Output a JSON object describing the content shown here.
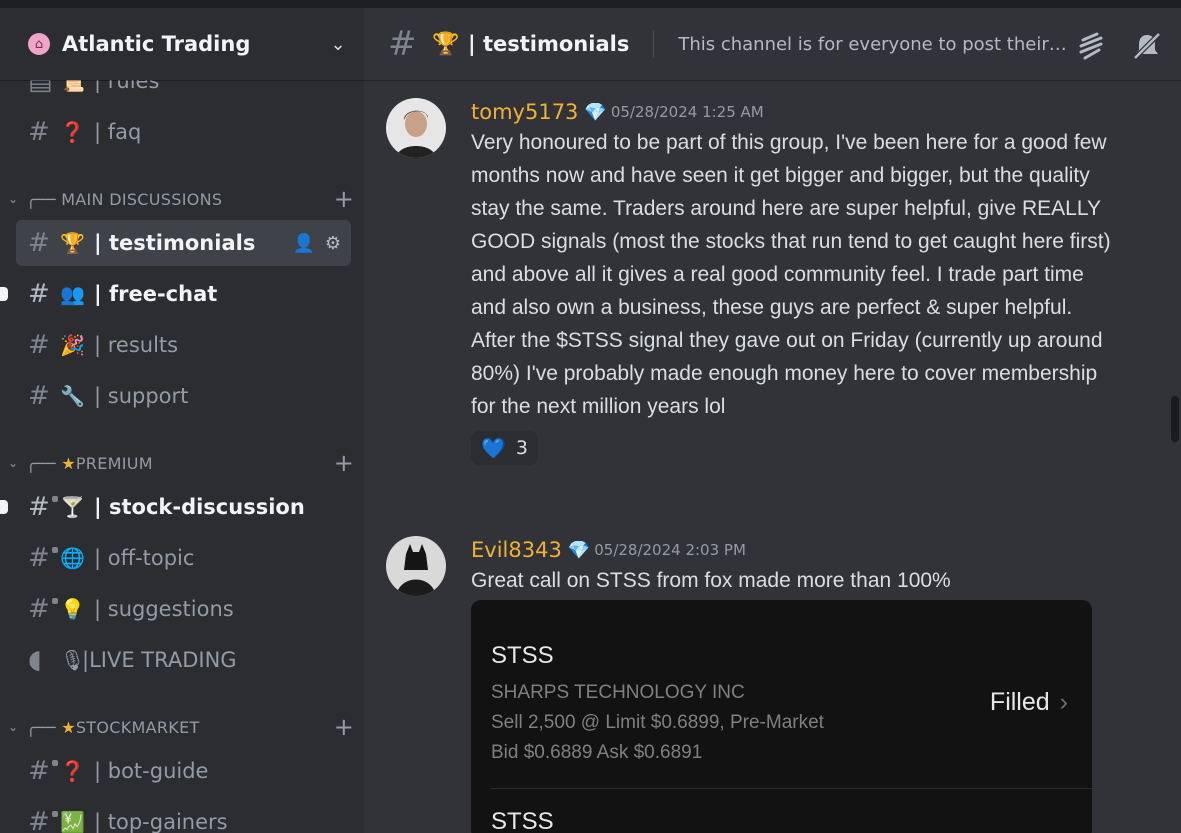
{
  "server": {
    "name": "Atlantic Trading",
    "icon": "house-icon"
  },
  "sidebar": {
    "channels_top": [
      {
        "emoji": "📜",
        "label": "| rules"
      },
      {
        "emoji": "❓",
        "label": "| faq"
      }
    ],
    "categories": [
      {
        "name": "MAIN DISCUSSIONS",
        "channels": [
          {
            "emoji": "🏆",
            "label": "| testimonials",
            "active": true
          },
          {
            "emoji": "👥",
            "label": "| free-chat",
            "unread": true
          },
          {
            "emoji": "🎉",
            "label": "| results"
          },
          {
            "emoji": "🔧",
            "label": "| support"
          }
        ]
      },
      {
        "name": "PREMIUM",
        "channels": [
          {
            "emoji": "🍸",
            "label": "| stock-discussion",
            "unread": true
          },
          {
            "emoji": "🌐",
            "label": "| off-topic"
          },
          {
            "emoji": "💡",
            "label": "| suggestions"
          },
          {
            "emoji": "🎙",
            "label": "|LIVE TRADING"
          }
        ]
      },
      {
        "name": "STOCKMARKET",
        "channels": [
          {
            "emoji": "❓",
            "label": "| bot-guide"
          },
          {
            "emoji": "💹",
            "label": "| top-gainers"
          }
        ]
      }
    ]
  },
  "header": {
    "emoji": "🏆",
    "title": "| testimonials",
    "topic": "This channel is for everyone to post their ..."
  },
  "messages": [
    {
      "username": "tomy5173",
      "badge": "💎",
      "timestamp": "05/28/2024 1:25 AM",
      "text": "Very honoured to be part of this group, I've been here for a good few months now and have seen it get bigger and bigger, but the quality stay the same. Traders around here are super helpful, give REALLY GOOD signals (most the stocks that run tend to get caught here first) and above all it gives a real good community feel. I trade part time and also own a business, these guys are perfect & super helpful. After the $STSS signal they gave out on Friday (currently up around 80%) I've probably made enough money here to cover membership for the next million years lol",
      "reaction": {
        "emoji": "💙",
        "count": "3"
      }
    },
    {
      "username": "Evil8343",
      "badge": "💎",
      "timestamp": "05/28/2024 2:03 PM",
      "text": "Great call on STSS from fox made more than 100%",
      "attachment": {
        "symbol": "STSS",
        "company": "SHARPS TECHNOLOGY INC",
        "order": "Sell 2,500 @ Limit $0.6899, Pre-Market",
        "bidask": "Bid $0.6889 Ask $0.6891",
        "status": "Filled",
        "next_symbol": "STSS"
      }
    }
  ],
  "colors": {
    "username": "#f0b232",
    "active_bg": "#404249",
    "sidebar_bg": "#2b2d31",
    "main_bg": "#313338"
  }
}
